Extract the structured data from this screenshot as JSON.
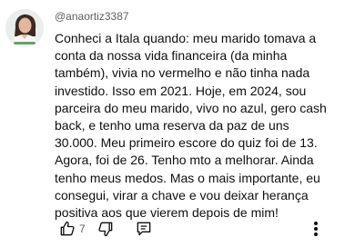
{
  "comment": {
    "author": "@anaortiz3387",
    "lines": [
      "Conheci a Itala quando: meu marido tomava a",
      "conta da nossa vida financeira (da minha",
      "também), vivia no vermelho e não tinha nada",
      "investido. Isso em 2021. Hoje, em 2024, sou",
      "parceira do meu marido, vivo no azul, gero cash",
      "back, e tenho uma reserva da paz de uns",
      "30.000. Meu primeiro escore do quiz foi de 13.",
      "Agora, foi de 26. Tenho mto a melhorar. Ainda",
      "tenho meus medos. Mas o mais importante, eu",
      "consegui, virar a chave e vou deixar herança",
      "positiva aos que vierem depois de mim!"
    ],
    "like_count": "7"
  },
  "icons": {
    "avatar": "avatar",
    "like": "thumbs-up-icon",
    "dislike": "thumbs-down-icon",
    "reply": "reply-icon",
    "menu": "more-vert-icon"
  },
  "colors": {
    "text": "#0f0f0f",
    "secondary_text": "#606060",
    "background": "#ffffff"
  }
}
